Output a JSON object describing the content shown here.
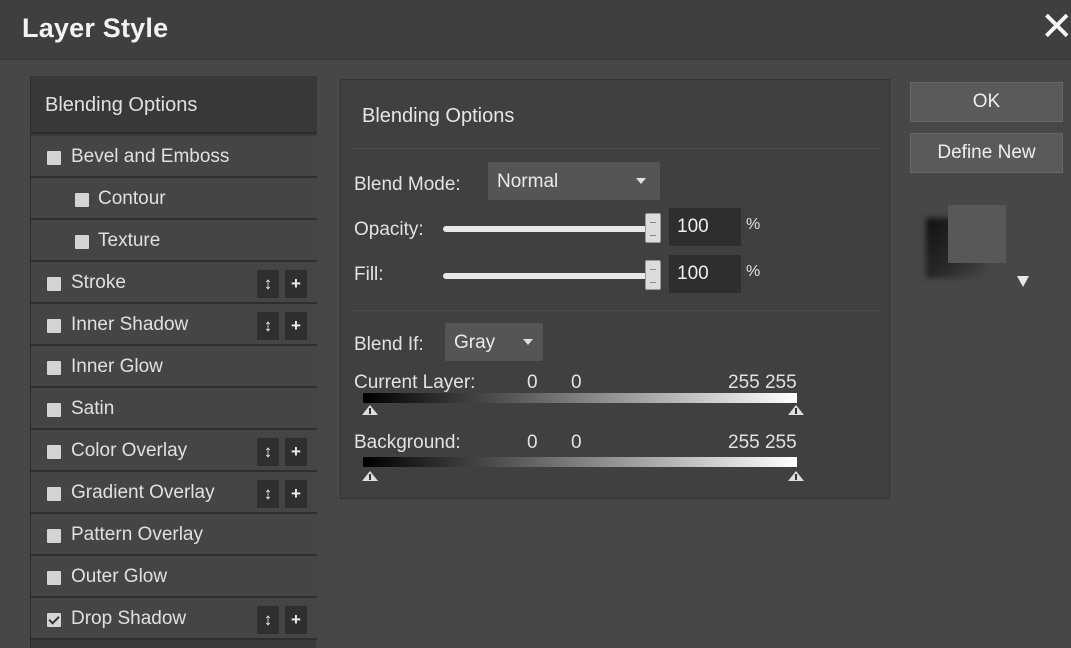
{
  "dialog": {
    "title": "Layer Style",
    "close_glyph": "✕"
  },
  "sidebar": {
    "header": "Blending Options",
    "items": [
      {
        "label": "Bevel and Emboss",
        "checked": false
      },
      {
        "label": "Contour",
        "checked": false
      },
      {
        "label": "Texture",
        "checked": false
      },
      {
        "label": "Stroke",
        "checked": false
      },
      {
        "label": "Inner Shadow",
        "checked": false
      },
      {
        "label": "Inner Glow",
        "checked": false
      },
      {
        "label": "Satin",
        "checked": false
      },
      {
        "label": "Color Overlay",
        "checked": false
      },
      {
        "label": "Gradient Overlay",
        "checked": false
      },
      {
        "label": "Pattern Overlay",
        "checked": false
      },
      {
        "label": "Outer Glow",
        "checked": false
      },
      {
        "label": "Drop Shadow",
        "checked": true
      }
    ],
    "reorder_glyph": "↕",
    "add_glyph": "+"
  },
  "panel": {
    "title": "Blending Options",
    "blend_mode_label": "Blend Mode:",
    "blend_mode_value": "Normal",
    "opacity_label": "Opacity:",
    "opacity_value": "100",
    "opacity_unit": "%",
    "fill_label": "Fill:",
    "fill_value": "100",
    "fill_unit": "%",
    "blend_if_label": "Blend If:",
    "blend_if_value": "Gray",
    "current_layer": {
      "label": "Current Layer:",
      "low1": "0",
      "low2": "0",
      "high": "255 255"
    },
    "background": {
      "label": "Background:",
      "low1": "0",
      "low2": "0",
      "high": "255 255"
    }
  },
  "buttons": {
    "ok": "OK",
    "define_new": "Define New"
  }
}
